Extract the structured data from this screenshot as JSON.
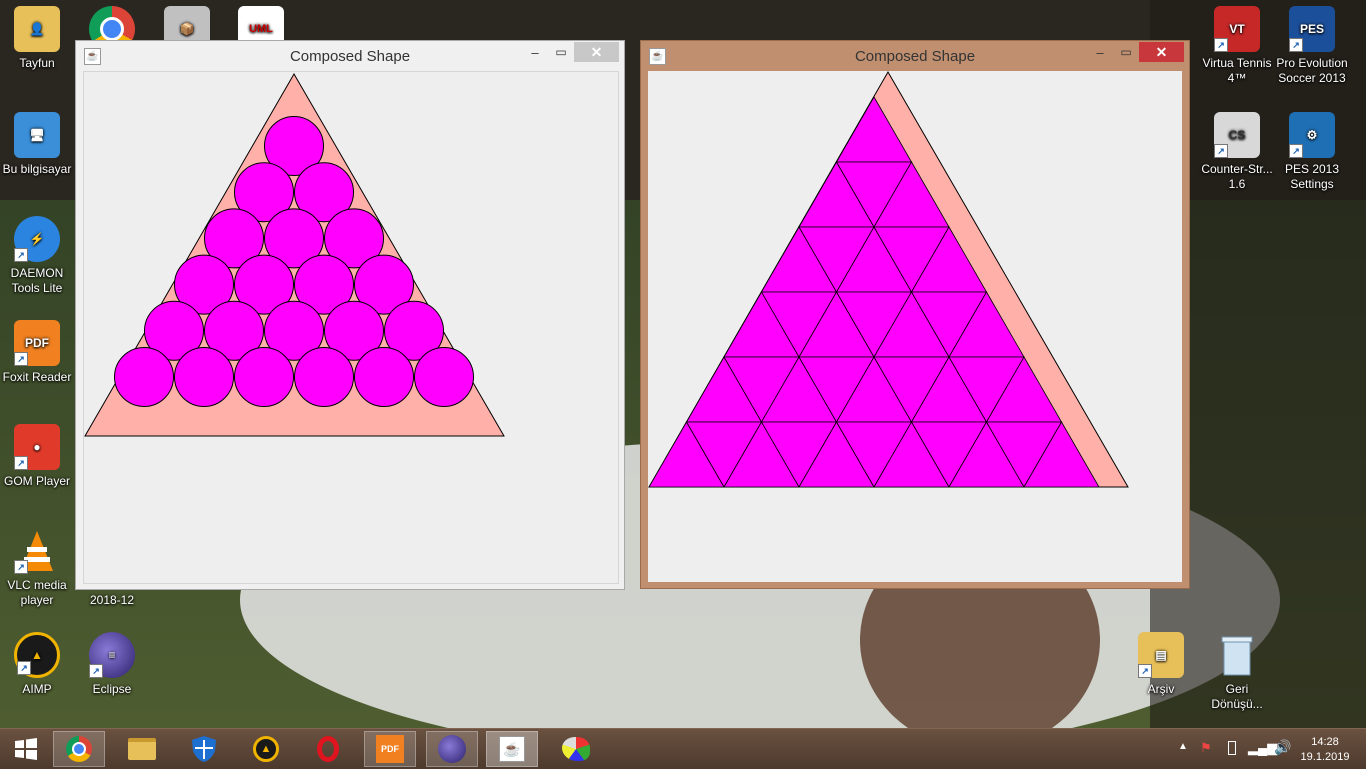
{
  "desktop": {
    "left_icons": [
      {
        "label": "Tayfun",
        "icon": "user-folder-icon",
        "color": "#e8c05a"
      },
      {
        "label": "Bu bilgisayar",
        "icon": "computer-icon",
        "color": "#3a8fd8"
      },
      {
        "label": "DAEMON Tools Lite",
        "icon": "daemon-tools-icon",
        "color": "#2a84e0"
      },
      {
        "label": "Foxit Reader",
        "icon": "foxit-reader-icon",
        "color": "#f08020"
      },
      {
        "label": "GOM Player",
        "icon": "gom-player-icon",
        "color": "#e03a2a"
      },
      {
        "label": "VLC media player",
        "icon": "vlc-cone-icon",
        "color": "#f58a07"
      },
      {
        "label": "AIMP",
        "icon": "aimp-icon",
        "color": "#f0b400"
      }
    ],
    "second_column": [
      {
        "label": "Eclipse",
        "icon": "eclipse-icon",
        "color": "#4a3a8a"
      }
    ],
    "partial_label": "2018-12",
    "right_icons": [
      {
        "label": "Virtua Tennis 4™",
        "icon": "virtua-tennis-icon",
        "color": "#c62828"
      },
      {
        "label": "Pro Evolution Soccer 2013",
        "icon": "pes-2013-icon",
        "color": "#1c4f9a"
      },
      {
        "label": "Counter-Str... 1.6",
        "icon": "counter-strike-icon",
        "color": "#3a3a3a"
      },
      {
        "label": "PES 2013 Settings",
        "icon": "pes-settings-icon",
        "color": "#1f6fb4"
      },
      {
        "label": "Arşiv",
        "icon": "folder-icon",
        "color": "#e8c05a"
      },
      {
        "label": "Geri Dönüşü...",
        "icon": "recycle-bin-icon",
        "color": "#a8c8e0"
      }
    ],
    "top_icon_labels": {
      "uml": "UML"
    }
  },
  "windows": [
    {
      "title": "Composed Shape",
      "controls": {
        "minimize": "‒",
        "maximize": "▭",
        "close": "✕"
      },
      "shape": {
        "container": "triangle",
        "inner": "circles",
        "container_color": "#ffb0a8",
        "inner_color": "#ff00ff",
        "rows": 6
      }
    },
    {
      "title": "Composed Shape",
      "controls": {
        "minimize": "‒",
        "maximize": "▭",
        "close": "✕"
      },
      "shape": {
        "container": "triangle",
        "inner": "triangles",
        "container_color": "#ffb0a8",
        "inner_color": "#ff00ff",
        "rows": 6
      }
    }
  ],
  "taskbar": {
    "start_icon": "windows-logo-icon",
    "apps": [
      {
        "name": "chrome",
        "icon": "chrome-icon"
      },
      {
        "name": "explorer",
        "icon": "file-explorer-icon"
      },
      {
        "name": "defender",
        "icon": "shield-icon"
      },
      {
        "name": "aimp",
        "icon": "aimp-icon"
      },
      {
        "name": "opera",
        "icon": "opera-icon"
      },
      {
        "name": "foxit",
        "icon": "foxit-reader-icon"
      },
      {
        "name": "eclipse",
        "icon": "eclipse-icon"
      },
      {
        "name": "java",
        "icon": "java-icon"
      },
      {
        "name": "paint",
        "icon": "paint-palette-icon"
      }
    ],
    "clock": {
      "time": "14:28",
      "date": "19.1.2019"
    }
  }
}
